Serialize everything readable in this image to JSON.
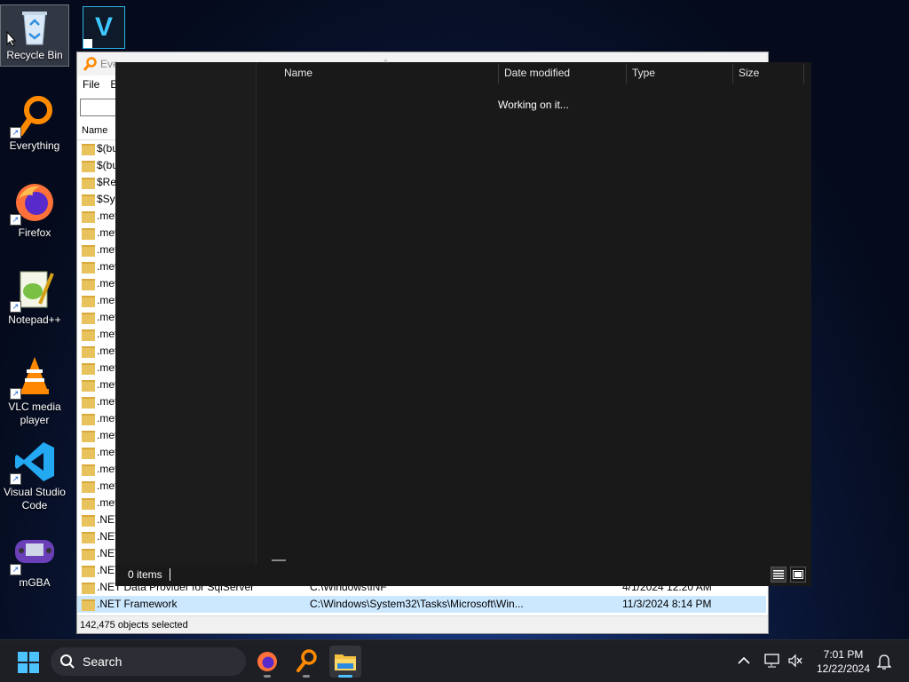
{
  "desktop": {
    "icons": [
      {
        "label": "Recycle Bin"
      },
      {
        "label": "Everything"
      },
      {
        "label": "Firefox"
      },
      {
        "label": "Notepad++"
      },
      {
        "label": "VLC media player"
      },
      {
        "label": "Visual Studio Code"
      },
      {
        "label": "mGBA"
      }
    ],
    "top_icon_letter": "V"
  },
  "everything_window": {
    "title": "Eve",
    "menu": [
      "File",
      "E"
    ],
    "column_name": "Name",
    "rows": [
      {
        "name": "$(bu",
        "path": "",
        "date": ""
      },
      {
        "name": "$(bu",
        "path": "",
        "date": ""
      },
      {
        "name": "$Rec",
        "path": "",
        "date": ""
      },
      {
        "name": "$Sys",
        "path": "",
        "date": ""
      },
      {
        "name": ".met",
        "path": "",
        "date": ""
      },
      {
        "name": ".met",
        "path": "",
        "date": ""
      },
      {
        "name": ".met",
        "path": "",
        "date": ""
      },
      {
        "name": ".met",
        "path": "",
        "date": ""
      },
      {
        "name": ".met",
        "path": "",
        "date": ""
      },
      {
        "name": ".met",
        "path": "",
        "date": ""
      },
      {
        "name": ".met",
        "path": "",
        "date": ""
      },
      {
        "name": ".met",
        "path": "",
        "date": ""
      },
      {
        "name": ".met",
        "path": "",
        "date": ""
      },
      {
        "name": ".met",
        "path": "",
        "date": ""
      },
      {
        "name": ".met",
        "path": "",
        "date": ""
      },
      {
        "name": ".met",
        "path": "",
        "date": ""
      },
      {
        "name": ".met",
        "path": "",
        "date": ""
      },
      {
        "name": ".met",
        "path": "",
        "date": ""
      },
      {
        "name": ".met",
        "path": "",
        "date": ""
      },
      {
        "name": ".met",
        "path": "",
        "date": ""
      },
      {
        "name": ".met",
        "path": "",
        "date": ""
      },
      {
        "name": ".met",
        "path": "",
        "date": ""
      },
      {
        "name": ".NET",
        "path": "",
        "date": ""
      },
      {
        "name": ".NET",
        "path": "",
        "date": ""
      },
      {
        "name": ".NET",
        "path": "",
        "date": ""
      },
      {
        "name": ".NET",
        "path": "",
        "date": ""
      },
      {
        "name": ".NET Data Provider for SqlServer",
        "path": "C:\\Windows\\INF",
        "date": "4/1/2024 12:20 AM"
      },
      {
        "name": ".NET Framework",
        "path": "C:\\Windows\\System32\\Tasks\\Microsoft\\Win...",
        "date": "11/3/2024 8:14 PM"
      }
    ],
    "status": "142,475 objects selected"
  },
  "explorer_window": {
    "columns": [
      "Name",
      "Date modified",
      "Type",
      "Size"
    ],
    "working_text": "Working on it...",
    "items_count": "0 items"
  },
  "taskbar": {
    "search_label": "Search",
    "time": "7:01 PM",
    "date": "12/22/2024"
  }
}
